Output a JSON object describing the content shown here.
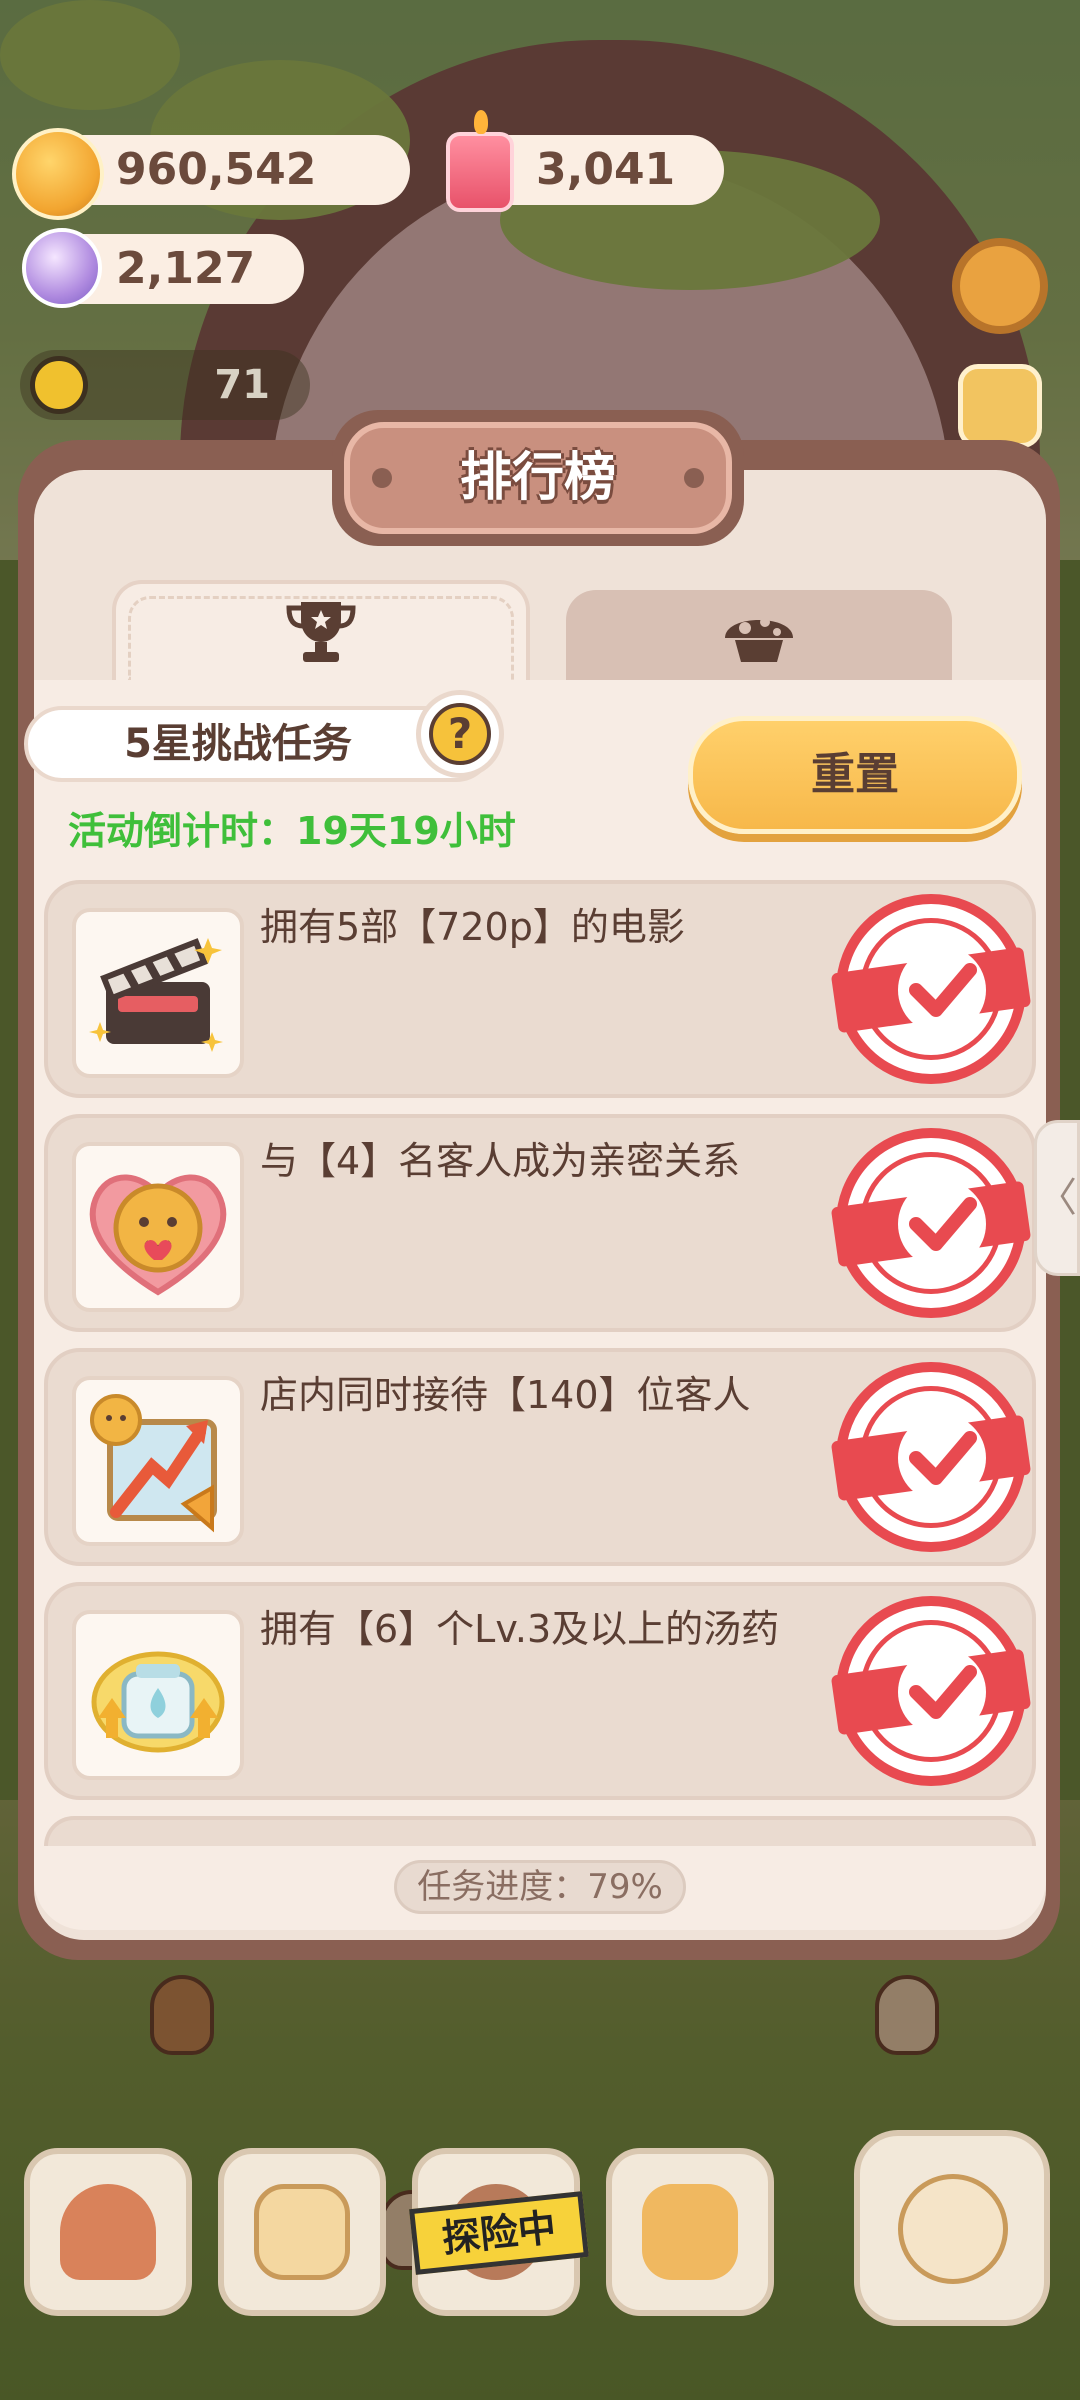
{
  "currency": {
    "coins": "960,542",
    "candles": "3,041",
    "candies": "2,127"
  },
  "status": {
    "level_value": "71"
  },
  "dialog": {
    "title": "排行榜",
    "tabs": [
      {
        "icon": "trophy-icon",
        "active": true
      },
      {
        "icon": "mushroom-icon",
        "active": false
      }
    ],
    "task_label": "5星挑战任务",
    "help_symbol": "?",
    "countdown": "活动倒计时：19天19小时",
    "reset_label": "重置",
    "tasks": [
      {
        "text": "拥有5部【720p】的电影",
        "icon": "clapperboard-icon",
        "completed": true
      },
      {
        "text": "与【4】名客人成为亲密关系",
        "icon": "cookie-heart-icon",
        "completed": true
      },
      {
        "text": "店内同时接待【140】位客人",
        "icon": "growth-arrow-icon",
        "completed": true
      },
      {
        "text": "拥有【6】个Lv.3及以上的汤药",
        "icon": "potion-upgrade-icon",
        "completed": true
      }
    ],
    "progress": "任务进度：79%",
    "side_arrow": "〈"
  },
  "bottom_nav": {
    "items": [
      "mushroom-house-icon",
      "recipe-notebook-icon",
      "explore-icon",
      "shop-counter-icon",
      "fish-pet-icon"
    ],
    "explore_tag": "探险中"
  },
  "colors": {
    "panel_brown": "#8a5f52",
    "panel_bg": "#f7ece4",
    "accent_green": "#3fbf3a",
    "button_yellow": "#f7b84a",
    "stamp_red": "#e84a50"
  }
}
